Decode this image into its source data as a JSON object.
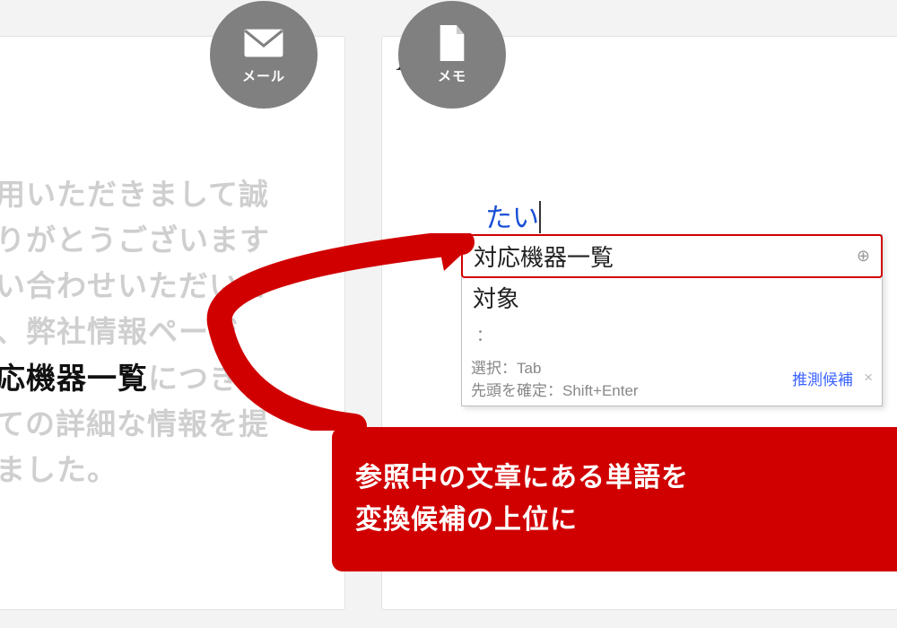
{
  "badge_mail": {
    "label": "メール"
  },
  "badge_memo": {
    "label": "メモ"
  },
  "memo_caret": "A",
  "mail_body": {
    "pre1": "利用いただきまして誠",
    "pre2": "ありがとうございます",
    "pre3": "問い合わせいただいて",
    "pre4": "た、弊社情報ページ",
    "highlight": "対応機器一覧",
    "post_h": "につき",
    "post1": "しての詳細な情報を提",
    "post2": "しました。"
  },
  "ime": {
    "input": "たい",
    "candidate_top": "対応機器一覧",
    "candidate_2": "対象",
    "dots": "：",
    "key1": "選択：Tab",
    "key2": "先頭を確定：Shift+Enter",
    "pred": "推測候補",
    "close": "×"
  },
  "callout": {
    "line1": "参照中の文章にある単語を",
    "line2": "変換候補の上位に"
  }
}
